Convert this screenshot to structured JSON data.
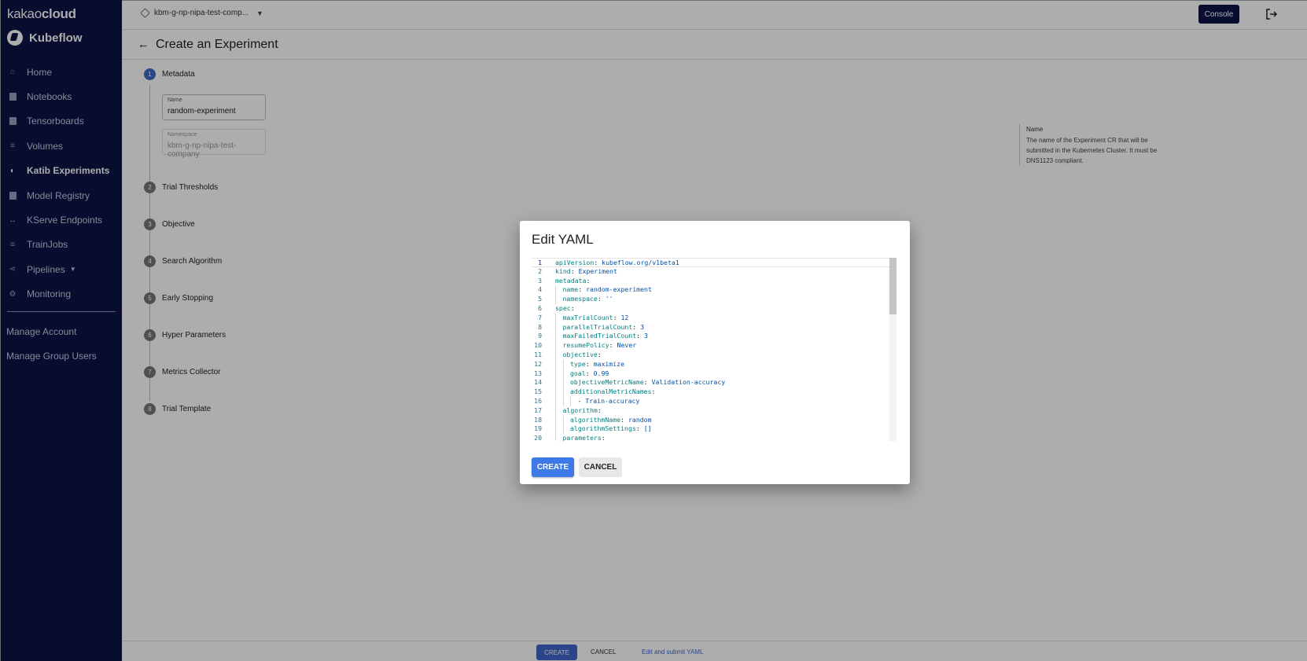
{
  "brand": {
    "name_light": "kakao",
    "name_bold": "cloud",
    "product": "Kubeflow"
  },
  "sidebar": {
    "items": [
      {
        "label": "Home",
        "icon": "home-icon"
      },
      {
        "label": "Notebooks",
        "icon": "notebook-icon"
      },
      {
        "label": "Tensorboards",
        "icon": "tensorboard-icon"
      },
      {
        "label": "Volumes",
        "icon": "volumes-icon"
      },
      {
        "label": "Katib Experiments",
        "icon": "katib-icon",
        "active": true
      },
      {
        "label": "Model Registry",
        "icon": "model-registry-icon"
      },
      {
        "label": "KServe Endpoints",
        "icon": "kserve-icon"
      },
      {
        "label": "TrainJobs",
        "icon": "trainjobs-icon"
      },
      {
        "label": "Pipelines",
        "icon": "pipelines-icon"
      },
      {
        "label": "Monitoring",
        "icon": "monitoring-icon"
      }
    ],
    "account_items": [
      {
        "label": "Manage Account"
      },
      {
        "label": "Manage Group Users"
      }
    ]
  },
  "topbar": {
    "namespace": "kbm-g-np-nipa-test-comp...",
    "console_label": "Console"
  },
  "page": {
    "title": "Create an Experiment",
    "steps": [
      {
        "num": "1",
        "label": "Metadata"
      },
      {
        "num": "2",
        "label": "Trial Thresholds"
      },
      {
        "num": "3",
        "label": "Objective"
      },
      {
        "num": "4",
        "label": "Search Algorithm"
      },
      {
        "num": "5",
        "label": "Early Stopping"
      },
      {
        "num": "6",
        "label": "Hyper Parameters"
      },
      {
        "num": "7",
        "label": "Metrics Collector"
      },
      {
        "num": "8",
        "label": "Trial Template"
      }
    ],
    "name_field": {
      "label": "Name",
      "value": "random-experiment"
    },
    "namespace_field": {
      "label": "Namespace",
      "value": "kbm-g-np-nipa-test-company"
    },
    "help": {
      "title": "Name",
      "text": "The name of the Experiment CR that will be submitted in the Kubernetes Cluster. It must be DNS1123 compliant."
    }
  },
  "dialog": {
    "title": "Edit YAML",
    "create_label": "CREATE",
    "cancel_label": "CANCEL",
    "yaml_lines": [
      {
        "n": "1",
        "indent": 0,
        "key": "apiVersion",
        "value": "kubeflow.org/v1beta1"
      },
      {
        "n": "2",
        "indent": 0,
        "key": "kind",
        "value": "Experiment"
      },
      {
        "n": "3",
        "indent": 0,
        "key": "metadata",
        "value": ""
      },
      {
        "n": "4",
        "indent": 1,
        "key": "name",
        "value": "random-experiment"
      },
      {
        "n": "5",
        "indent": 1,
        "key": "namespace",
        "value": "''"
      },
      {
        "n": "6",
        "indent": 0,
        "key": "spec",
        "value": ""
      },
      {
        "n": "7",
        "indent": 1,
        "key": "maxTrialCount",
        "value": "12"
      },
      {
        "n": "8",
        "indent": 1,
        "key": "parallelTrialCount",
        "value": "3"
      },
      {
        "n": "9",
        "indent": 1,
        "key": "maxFailedTrialCount",
        "value": "3"
      },
      {
        "n": "10",
        "indent": 1,
        "key": "resumePolicy",
        "value": "Never"
      },
      {
        "n": "11",
        "indent": 1,
        "key": "objective",
        "value": ""
      },
      {
        "n": "12",
        "indent": 2,
        "key": "type",
        "value": "maximize"
      },
      {
        "n": "13",
        "indent": 2,
        "key": "goal",
        "value": "0.99"
      },
      {
        "n": "14",
        "indent": 2,
        "key": "objectiveMetricName",
        "value": "Validation-accuracy"
      },
      {
        "n": "15",
        "indent": 2,
        "key": "additionalMetricNames",
        "value": ""
      },
      {
        "n": "16",
        "indent": 3,
        "key": "",
        "value": "Train-accuracy",
        "list": true
      },
      {
        "n": "17",
        "indent": 1,
        "key": "algorithm",
        "value": ""
      },
      {
        "n": "18",
        "indent": 2,
        "key": "algorithmName",
        "value": "random"
      },
      {
        "n": "19",
        "indent": 2,
        "key": "algorithmSettings",
        "value": "[]"
      },
      {
        "n": "20",
        "indent": 1,
        "key": "parameters",
        "value": ""
      }
    ]
  },
  "footer": {
    "create_label": "CREATE",
    "cancel_label": "CANCEL",
    "edit_label": "Edit and submit YAML"
  }
}
